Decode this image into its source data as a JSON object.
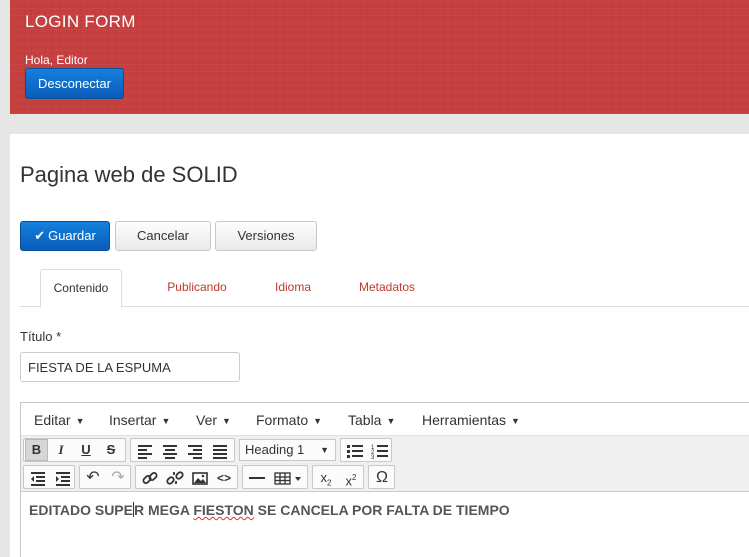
{
  "header": {
    "app_title": "LOGIN FORM",
    "greeting": "Hola, Editor",
    "logout_label": "Desconectar"
  },
  "page": {
    "title": "Pagina web de SOLID"
  },
  "actions": {
    "save_label": "Guardar",
    "cancel_label": "Cancelar",
    "versions_label": "Versiones"
  },
  "tabs": [
    {
      "label": "Contenido",
      "active": true
    },
    {
      "label": "Publicando",
      "active": false
    },
    {
      "label": "Idioma",
      "active": false
    },
    {
      "label": "Metadatos",
      "active": false
    }
  ],
  "form": {
    "title_label": "Título *",
    "title_value": "FIESTA DE LA ESPUMA"
  },
  "editor": {
    "menus": [
      "Editar",
      "Insertar",
      "Ver",
      "Formato",
      "Tabla",
      "Herramientas"
    ],
    "block_format": "Heading 1",
    "content_before_cursor": "EDITADO SUPE",
    "content_after_cursor": "R MEGA ",
    "content_misspelled": "FIESTON",
    "content_end": " SE CANCELA POR FALTA DE TIEMPO",
    "toolbar_icons": [
      "bold-icon",
      "italic-icon",
      "underline-icon",
      "strikethrough-icon",
      "align-left-icon",
      "align-center-icon",
      "align-right-icon",
      "align-justify-icon",
      "bullet-list-icon",
      "numbered-list-icon",
      "outdent-icon",
      "indent-icon",
      "undo-icon",
      "redo-icon",
      "link-icon",
      "unlink-icon",
      "image-icon",
      "code-icon",
      "horizontal-rule-icon",
      "table-icon",
      "subscript-icon",
      "superscript-icon",
      "special-char-icon"
    ]
  },
  "colors": {
    "header_bg": "#c5403f",
    "primary": "#1274d6",
    "tab_link": "#c0392b"
  }
}
